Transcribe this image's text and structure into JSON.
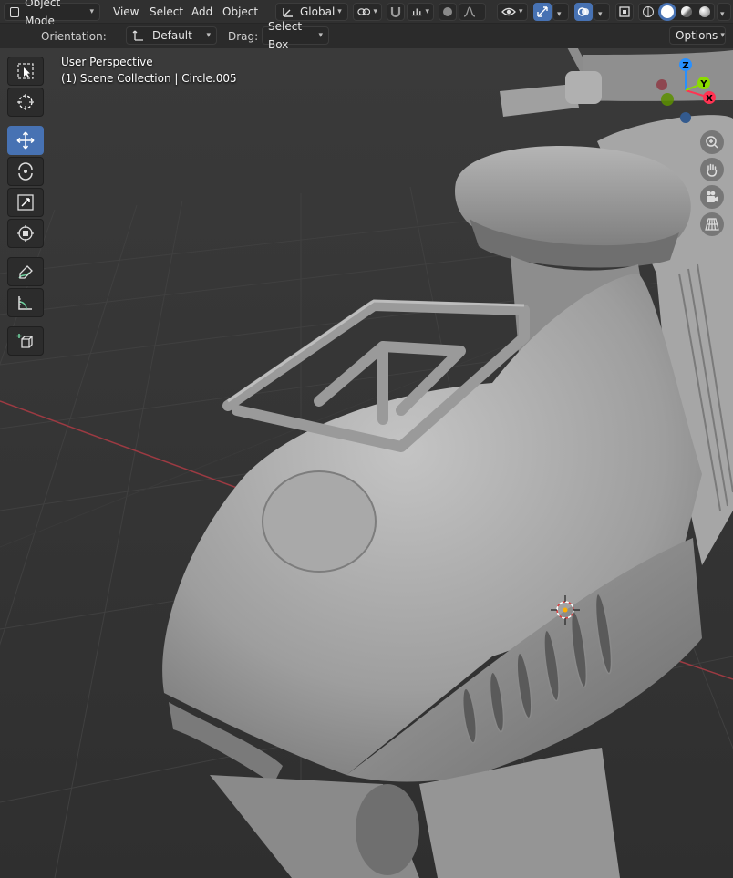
{
  "header": {
    "mode_label": "Object Mode",
    "menus": [
      "View",
      "Select",
      "Add",
      "Object"
    ],
    "transform_orientation": "Global"
  },
  "tool_settings": {
    "orientation_label": "Orientation:",
    "orientation_value": "Default",
    "drag_label": "Drag:",
    "drag_value": "Select Box",
    "options_label": "Options"
  },
  "viewport": {
    "perspective_label": "User Perspective",
    "collection_label": "(1) Scene Collection | Circle.005"
  },
  "gizmo": {
    "x": "X",
    "y": "Y",
    "z": "Z"
  },
  "colors": {
    "accent": "#4772b3",
    "axis_x": "#ff3352",
    "axis_y": "#8bdc00",
    "axis_z": "#2890ff",
    "grid_red": "#a0323a"
  }
}
